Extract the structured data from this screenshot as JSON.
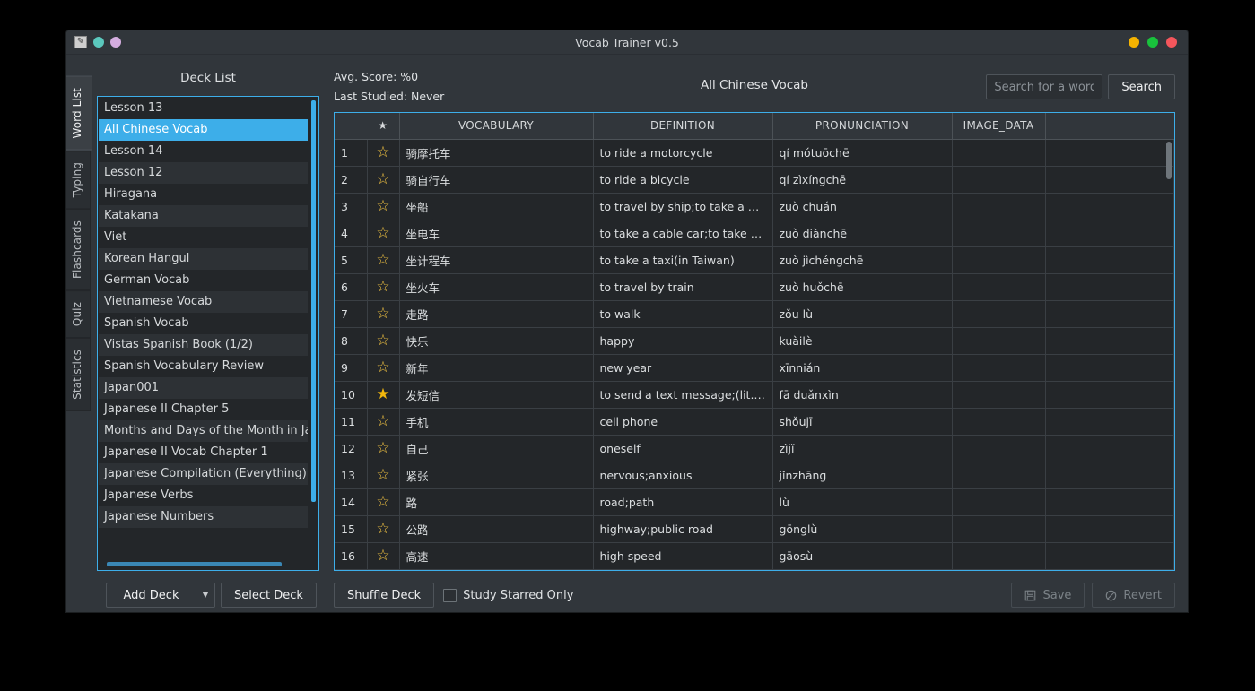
{
  "window": {
    "title": "Vocab Trainer v0.5",
    "app_icon": "app-icon",
    "left_dots": [
      "#5bc8bd",
      "#d5aee0"
    ],
    "controls": [
      {
        "name": "minimize",
        "color": "#f5b301"
      },
      {
        "name": "maximize",
        "color": "#19c23c"
      },
      {
        "name": "close",
        "color": "#f4565c"
      }
    ]
  },
  "tabs": [
    {
      "label": "Word List",
      "active": true
    },
    {
      "label": "Typing",
      "active": false
    },
    {
      "label": "Flashcards",
      "active": false
    },
    {
      "label": "Quiz",
      "active": false
    },
    {
      "label": "Statistics",
      "active": false
    }
  ],
  "deck_panel": {
    "title": "Deck List",
    "items": [
      {
        "label": "Lesson 13",
        "selected": false
      },
      {
        "label": "All Chinese Vocab",
        "selected": true
      },
      {
        "label": "Lesson 14",
        "selected": false
      },
      {
        "label": "Lesson 12",
        "selected": false
      },
      {
        "label": "Hiragana",
        "selected": false
      },
      {
        "label": "Katakana",
        "selected": false
      },
      {
        "label": "Viet",
        "selected": false
      },
      {
        "label": "Korean Hangul",
        "selected": false
      },
      {
        "label": "German Vocab",
        "selected": false
      },
      {
        "label": "Vietnamese Vocab",
        "selected": false
      },
      {
        "label": "Spanish Vocab",
        "selected": false
      },
      {
        "label": "Vistas Spanish Book (1/2)",
        "selected": false
      },
      {
        "label": "Spanish Vocabulary Review",
        "selected": false
      },
      {
        "label": "Japan001",
        "selected": false
      },
      {
        "label": "Japanese II Chapter 5",
        "selected": false
      },
      {
        "label": "Months and Days of the Month in Japa",
        "selected": false
      },
      {
        "label": "Japanese II Vocab Chapter 1",
        "selected": false
      },
      {
        "label": "Japanese Compilation (Everything)",
        "selected": false
      },
      {
        "label": "Japanese Verbs",
        "selected": false
      },
      {
        "label": "Japanese Numbers",
        "selected": false
      }
    ],
    "add_deck_label": "Add Deck",
    "add_deck_arrow": "▼",
    "select_deck_label": "Select Deck"
  },
  "header": {
    "avg_score": "Avg. Score: %0",
    "last_studied": "Last Studied: Never",
    "deck_name": "All Chinese Vocab",
    "search_placeholder": "Search for a word",
    "search_value": "",
    "search_button": "Search"
  },
  "table": {
    "columns": [
      "",
      "★",
      "VOCABULARY",
      "DEFINITION",
      "PRONUNCIATION",
      "IMAGE_DATA",
      ""
    ],
    "rows": [
      {
        "n": "1",
        "star": "outline",
        "vocab": "骑摩托车",
        "def": "to ride a motorcycle",
        "pron": "qí mótuōchē",
        "img": "",
        "hl": false
      },
      {
        "n": "2",
        "star": "outline",
        "vocab": "骑自行车",
        "def": "to ride a bicycle",
        "pron": "qí zìxíngchē",
        "img": "",
        "hl": false
      },
      {
        "n": "3",
        "star": "outline",
        "vocab": "坐船",
        "def": "to travel by ship;to take a boat",
        "pron": "zuò chuán",
        "img": "",
        "hl": false
      },
      {
        "n": "4",
        "star": "outline",
        "vocab": "坐电车",
        "def": "to take a cable car;to take a ...",
        "pron": "zuò diànchē",
        "img": "",
        "hl": false
      },
      {
        "n": "5",
        "star": "outline",
        "vocab": "坐计程车",
        "def": "to take a taxi(in Taiwan)",
        "pron": "zuò jìchéngchē",
        "img": "",
        "hl": false
      },
      {
        "n": "6",
        "star": "outline",
        "vocab": "坐火车",
        "def": "to travel by train",
        "pron": "zuò huǒchē",
        "img": "",
        "hl": false
      },
      {
        "n": "7",
        "star": "outline",
        "vocab": "走路",
        "def": "to walk",
        "pron": "zǒu lù",
        "img": "",
        "hl": false
      },
      {
        "n": "8",
        "star": "outline",
        "vocab": "快乐",
        "def": "happy",
        "pron": "kuàilè",
        "img": "",
        "hl": true
      },
      {
        "n": "9",
        "star": "outline",
        "vocab": "新年",
        "def": "new year",
        "pron": "xīnnián",
        "img": "",
        "hl": false
      },
      {
        "n": "10",
        "star": "filled",
        "vocab": "发短信",
        "def": "to send a text message;(lit.)to ...",
        "pron": "fā duǎnxìn",
        "img": "",
        "hl": false
      },
      {
        "n": "11",
        "star": "outline",
        "vocab": "手机",
        "def": "cell phone",
        "pron": "shǒujī",
        "img": "",
        "hl": false
      },
      {
        "n": "12",
        "star": "outline",
        "vocab": "自己",
        "def": "oneself",
        "pron": "zìjǐ",
        "img": "",
        "hl": false
      },
      {
        "n": "13",
        "star": "outline",
        "vocab": "紧张",
        "def": "nervous;anxious",
        "pron": "jǐnzhāng",
        "img": "",
        "hl": false
      },
      {
        "n": "14",
        "star": "outline",
        "vocab": "路",
        "def": "road;path",
        "pron": "lù",
        "img": "",
        "hl": false
      },
      {
        "n": "15",
        "star": "outline",
        "vocab": "公路",
        "def": "highway;public road",
        "pron": "gōnglù",
        "img": "",
        "hl": false
      },
      {
        "n": "16",
        "star": "outline",
        "vocab": "高速",
        "def": "high speed",
        "pron": "gāosù",
        "img": "",
        "hl": false
      }
    ]
  },
  "bottom": {
    "shuffle_label": "Shuffle Deck",
    "checkbox_label": "Study Starred Only",
    "checkbox_checked": false,
    "save_label": "Save",
    "save_icon": "floppy-disk-icon",
    "revert_label": "Revert",
    "revert_icon": "no-entry-icon"
  },
  "colors": {
    "accent": "#3daee9",
    "star": "#f5c542",
    "window_bg": "#31363b",
    "panel_bg": "#232629"
  }
}
